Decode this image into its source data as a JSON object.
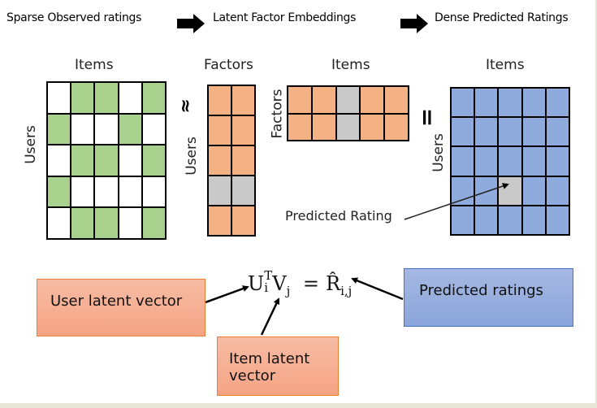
{
  "header": {
    "step1": "Sparse Observed ratings",
    "step2": "Latent Factor Embeddings",
    "step3": "Dense Predicted Ratings"
  },
  "colors": {
    "observed": "#a9d18e",
    "empty": "#ffffff",
    "factor": "#f4b183",
    "highlight": "#c9c9c9",
    "predicted": "#8faadc",
    "orange_border": "#ed7d31",
    "blue_border": "#4472c4"
  },
  "ratings_matrix": {
    "col_label": "Items",
    "row_label": "Users",
    "cells": [
      [
        0,
        1,
        1,
        0,
        1
      ],
      [
        1,
        0,
        0,
        1,
        0
      ],
      [
        0,
        1,
        1,
        0,
        1
      ],
      [
        1,
        0,
        0,
        0,
        0
      ],
      [
        0,
        1,
        1,
        0,
        1
      ]
    ]
  },
  "approx_symbol": "≈",
  "user_factors": {
    "col_label": "Factors",
    "row_label": "Users",
    "rows": 5,
    "cols": 2,
    "highlight_row": 3
  },
  "item_factors": {
    "col_label": "Items",
    "row_label": "Factors",
    "rows": 2,
    "cols": 5,
    "highlight_col": 2
  },
  "equals_symbol": "=",
  "predicted_matrix": {
    "col_label": "Items",
    "row_label": "Users",
    "rows": 5,
    "cols": 5,
    "highlight_cell": [
      3,
      2
    ]
  },
  "annotations": {
    "predicted_rating": "Predicted Rating",
    "user_latent_vector": "User latent vector",
    "item_latent_vector": "Item latent vector",
    "predicted_ratings": "Predicted ratings"
  },
  "formula": {
    "u": "U",
    "u_sub": "i",
    "u_sup": "T",
    "v": "V",
    "v_sub": "j",
    "equals": "=",
    "r": "R̂",
    "r_sub": "i,j"
  }
}
